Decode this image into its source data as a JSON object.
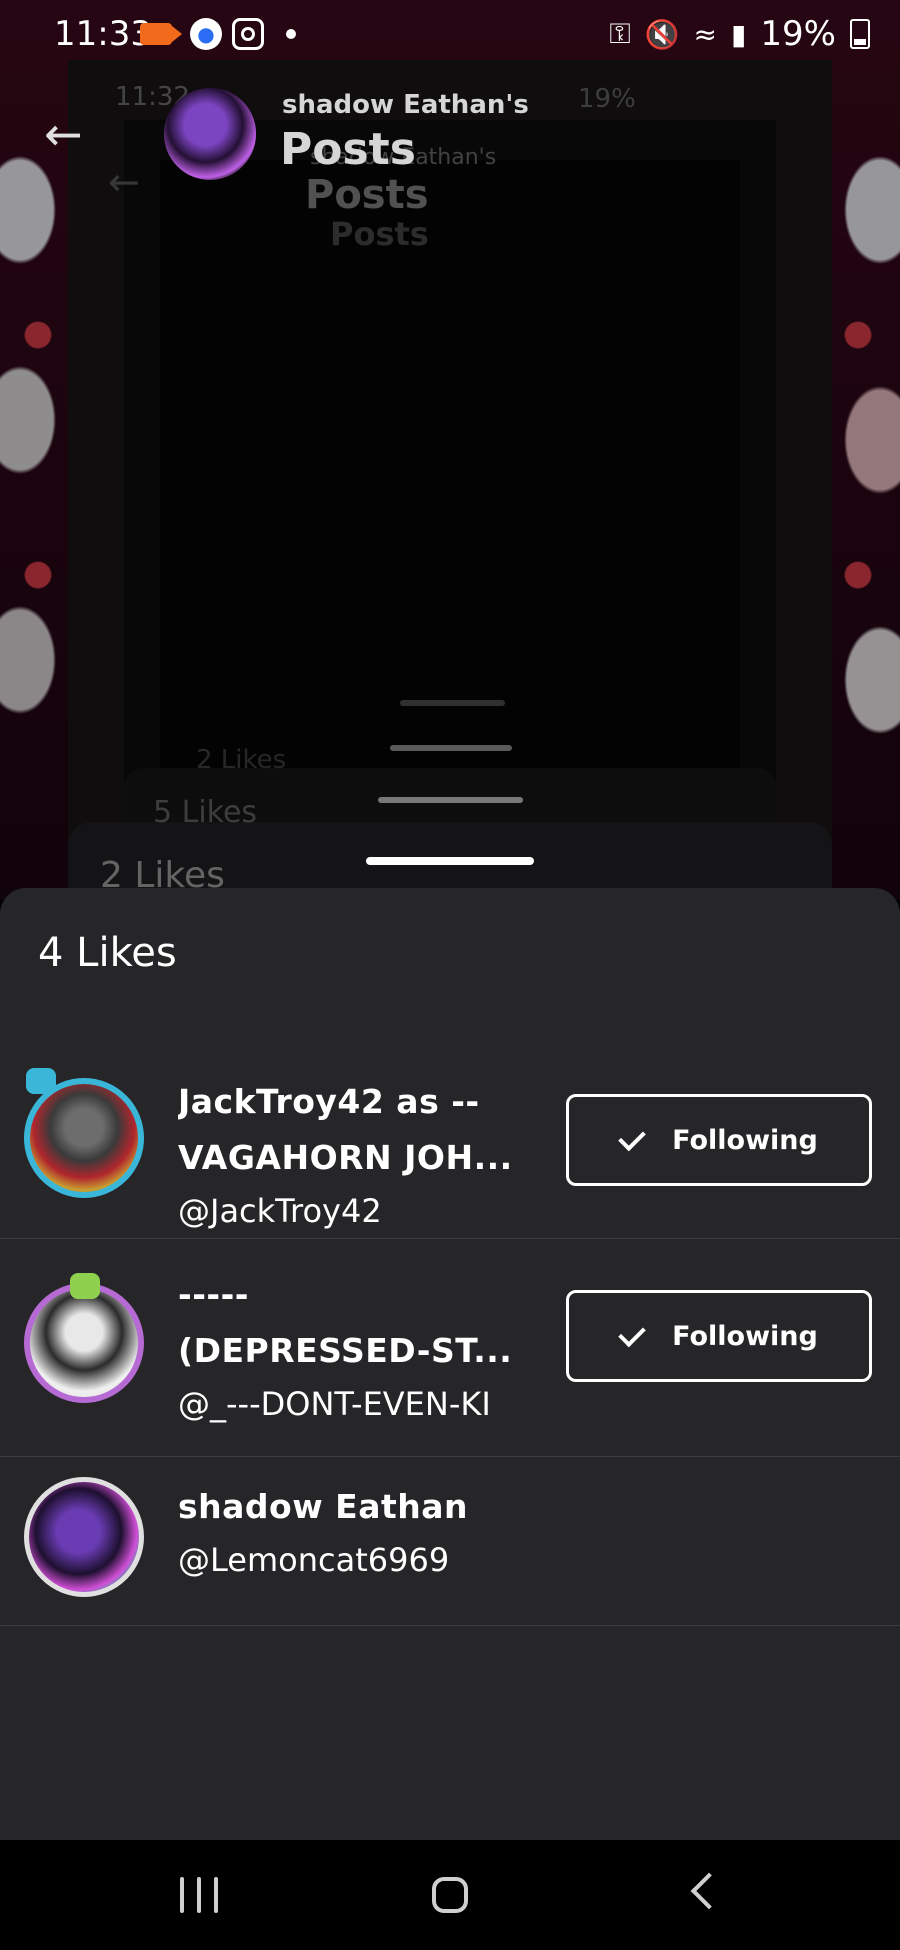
{
  "status_bar": {
    "time": "11:33",
    "battery": "19%",
    "notification_icons": [
      "video-call-icon",
      "app-icon",
      "instagram-icon",
      "dot-icon"
    ],
    "system_icons": [
      "vpn-key-icon",
      "mute-icon",
      "wifi-icon",
      "signal-icon",
      "battery-charging-icon"
    ]
  },
  "header": {
    "subtitle": "shadow Eathan's",
    "title": "Posts"
  },
  "background_ghost": {
    "status_time": "11:32",
    "status_battery": "19%",
    "subtitle": "shadow Eathan's",
    "title": "Posts",
    "likes_1": "2 Likes",
    "likes_2": "5 Likes",
    "likes_3": "2 Likes"
  },
  "likes_sheet": {
    "title": "4 Likes",
    "users": [
      {
        "name": "JackTroy42 as -- VAGAHORN JOH...",
        "name_line1": "JackTroy42 as --",
        "name_line2": "VAGAHORN JOH...",
        "handle": "@JackTroy42",
        "follow_label": "Following"
      },
      {
        "name": "----- (DEPRESSED-ST...",
        "name_line1": "-----",
        "name_line2": "(DEPRESSED-ST...",
        "handle": "@_---DONT-EVEN-KI",
        "follow_label": "Following"
      },
      {
        "name": "shadow Eathan",
        "handle": "@Lemoncat6969"
      }
    ]
  },
  "colors": {
    "sheet_background": "#262629",
    "accent_ring_1": "#3ab6d9",
    "accent_ring_2": "#b66ad3"
  }
}
